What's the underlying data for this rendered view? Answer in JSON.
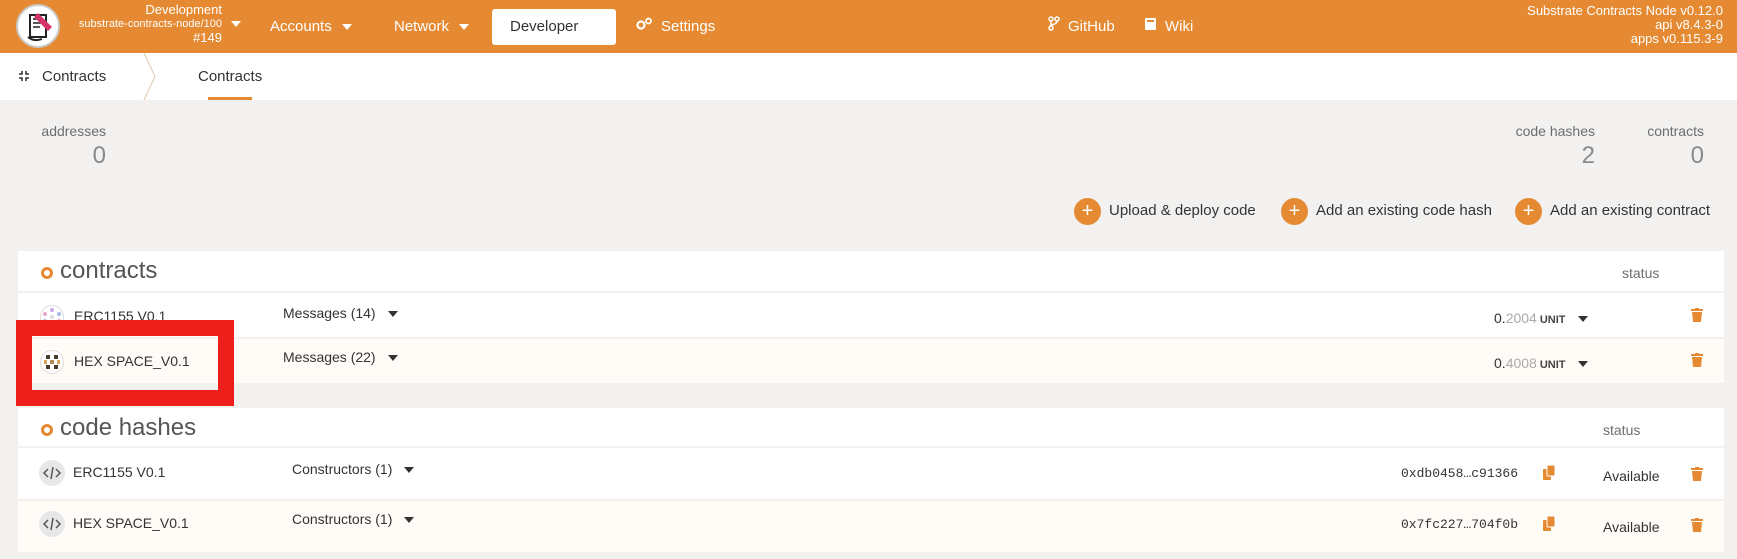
{
  "topbar": {
    "chain_name": "Development",
    "chain_node": "substrate-contracts-node/100",
    "chain_block": "#149",
    "nav": {
      "accounts": "Accounts",
      "network": "Network",
      "developer": "Developer",
      "settings": "Settings",
      "github": "GitHub",
      "wiki": "Wiki"
    },
    "versions": {
      "node": "Substrate Contracts Node v0.12.0",
      "api": "api v8.4.3-0",
      "apps": "apps v0.115.3-9"
    }
  },
  "tabbar": {
    "section": "Contracts",
    "tab": "Contracts"
  },
  "summary": {
    "addresses_label": "addresses",
    "addresses_value": "0",
    "code_hashes_label": "code hashes",
    "code_hashes_value": "2",
    "contracts_label": "contracts",
    "contracts_value": "0"
  },
  "actions": {
    "upload": "Upload & deploy code",
    "add_code_hash": "Add an existing code hash",
    "add_contract": "Add an existing contract"
  },
  "contracts": {
    "title": "contracts",
    "status_header": "status",
    "rows": [
      {
        "name": "ERC1155 V0.1",
        "messages": "Messages (14)",
        "balance_int": "0.",
        "balance_dec": "2004",
        "unit": "UNIT"
      },
      {
        "name": "HEX SPACE_V0.1",
        "messages": "Messages (22)",
        "balance_int": "0.",
        "balance_dec": "4008",
        "unit": "UNIT"
      }
    ]
  },
  "code_hashes": {
    "title": "code hashes",
    "status_header": "status",
    "rows": [
      {
        "name": "ERC1155 V0.1",
        "constructors": "Constructors (1)",
        "hash": "0xdb0458…c91366",
        "status": "Available"
      },
      {
        "name": "HEX SPACE_V0.1",
        "constructors": "Constructors (1)",
        "hash": "0x7fc227…704f0b",
        "status": "Available"
      }
    ]
  },
  "colors": {
    "accent": "#e58a32",
    "highlight": "#ee1f1a",
    "background": "#f2f1ef"
  }
}
